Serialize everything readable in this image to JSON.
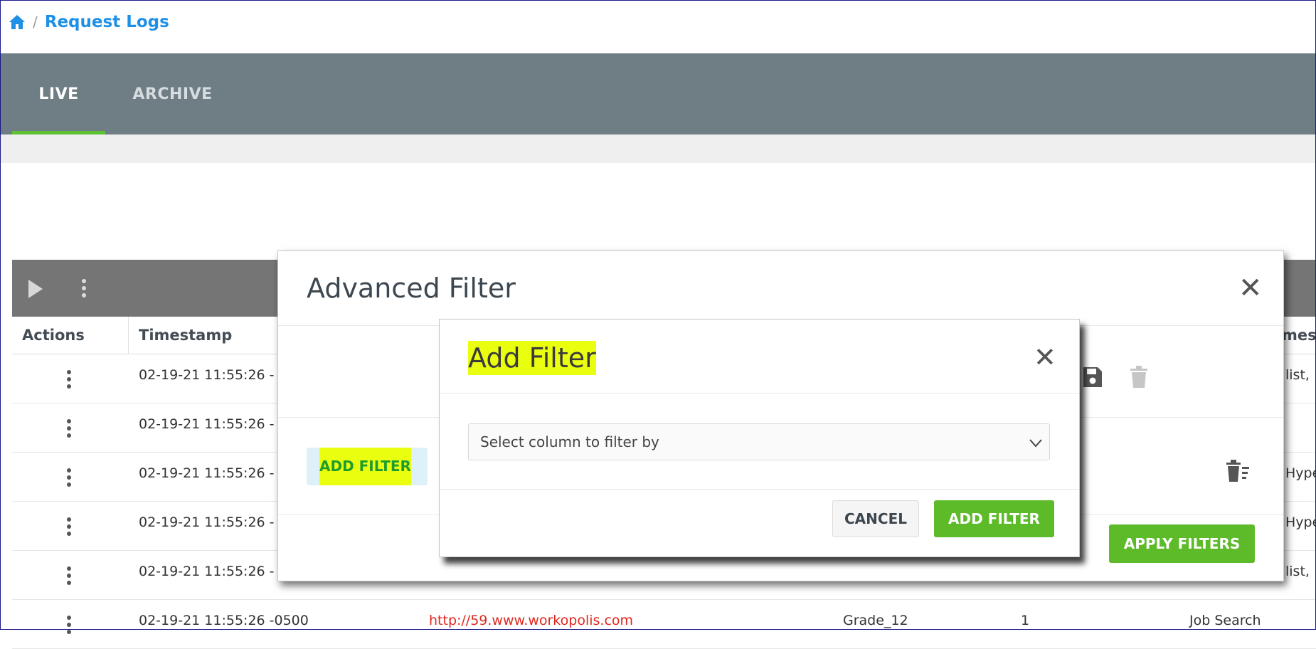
{
  "breadcrumb": {
    "current": "Request Logs",
    "separator": "/"
  },
  "tabs": [
    {
      "label": "LIVE",
      "active": true
    },
    {
      "label": "ARCHIVE",
      "active": false
    }
  ],
  "table": {
    "headers": {
      "actions": "Actions",
      "timestamp": "Timestamp",
      "partial_right": "mes"
    },
    "rows": [
      {
        "timestamp": "02-19-21 11:55:26 -",
        "right": "list,"
      },
      {
        "timestamp": "02-19-21 11:55:26 -",
        "right": ""
      },
      {
        "timestamp": "02-19-21 11:55:26 -",
        "right": "Hype"
      },
      {
        "timestamp": "02-19-21 11:55:26 -",
        "right": "Hype"
      },
      {
        "timestamp": "02-19-21 11:55:26 -",
        "right": "list,"
      }
    ],
    "last_row": {
      "timestamp": "02-19-21 11:55:26 -0500",
      "url": "http://59.www.workopolis.com",
      "grade": "Grade_12",
      "count": "1",
      "category": "Job Search"
    }
  },
  "advanced_filter": {
    "title": "Advanced Filter",
    "add_filter_label": "ADD FILTER",
    "apply_label": "APPLY FILTERS"
  },
  "add_filter_modal": {
    "title": "Add Filter",
    "select_placeholder": "Select column to filter by",
    "cancel_label": "CANCEL",
    "add_label": "ADD FILTER"
  },
  "colors": {
    "accent_blue": "#1e90e6",
    "green": "#5dbb2a",
    "highlight": "#eaff10",
    "link_red": "#e0271f"
  }
}
